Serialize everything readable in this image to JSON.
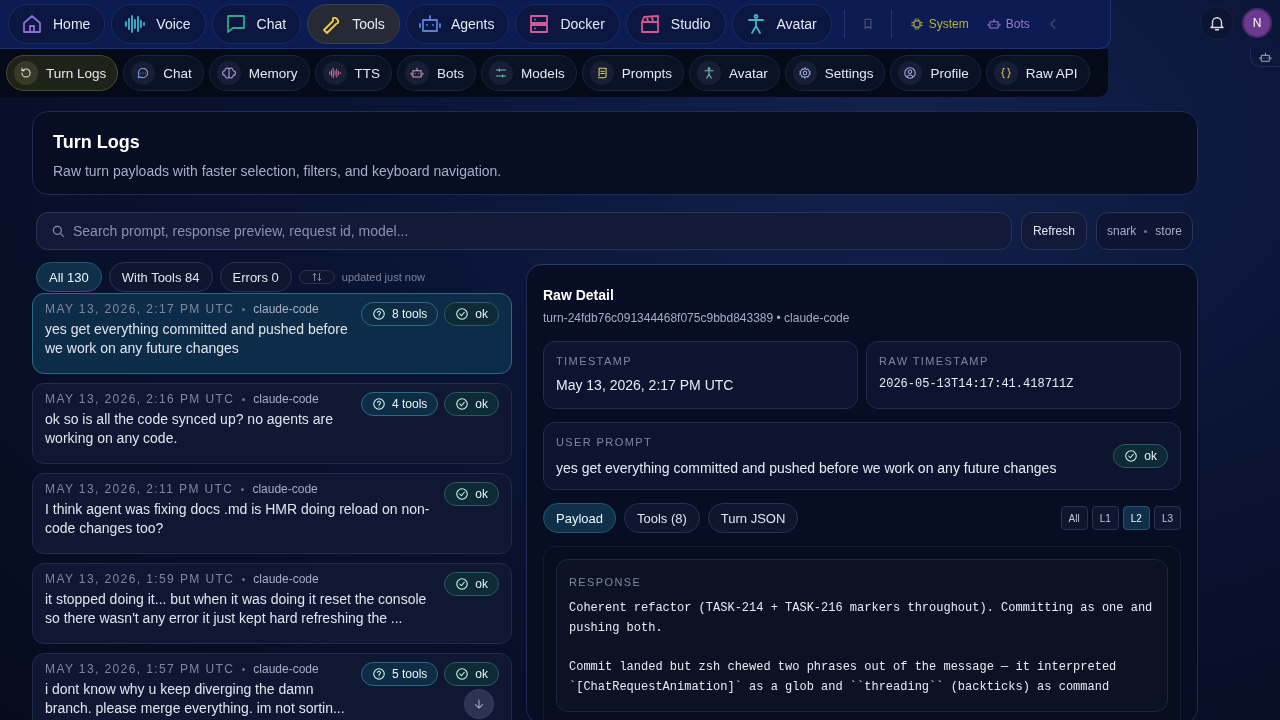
{
  "top_nav": [
    {
      "label": "Home",
      "selected": false
    },
    {
      "label": "Voice",
      "selected": false
    },
    {
      "label": "Chat",
      "selected": false
    },
    {
      "label": "Tools",
      "selected": true
    },
    {
      "label": "Agents",
      "selected": false
    },
    {
      "label": "Docker",
      "selected": false
    },
    {
      "label": "Studio",
      "selected": false
    },
    {
      "label": "Avatar",
      "selected": false
    }
  ],
  "top_links": [
    {
      "label": "System"
    },
    {
      "label": "Bots"
    }
  ],
  "user": {
    "initial": "N"
  },
  "sub_nav": [
    {
      "label": "Turn Logs",
      "selected": true
    },
    {
      "label": "Chat",
      "selected": false
    },
    {
      "label": "Memory",
      "selected": false
    },
    {
      "label": "TTS",
      "selected": false
    },
    {
      "label": "Bots",
      "selected": false
    },
    {
      "label": "Models",
      "selected": false
    },
    {
      "label": "Prompts",
      "selected": false
    },
    {
      "label": "Avatar",
      "selected": false
    },
    {
      "label": "Settings",
      "selected": false
    },
    {
      "label": "Profile",
      "selected": false
    },
    {
      "label": "Raw API",
      "selected": false
    }
  ],
  "header": {
    "title": "Turn Logs",
    "subtitle": "Raw turn payloads with faster selection, filters, and keyboard navigation."
  },
  "search": {
    "placeholder": "Search prompt, response preview, request id, model..."
  },
  "refresh_button": "Refresh",
  "source_chip": {
    "left": "snark",
    "right": "store"
  },
  "filters": [
    {
      "label": "All 130",
      "selected": true
    },
    {
      "label": "With Tools 84",
      "selected": false
    },
    {
      "label": "Errors 0",
      "selected": false
    }
  ],
  "updated": "updated just now",
  "turns": [
    {
      "timestamp": "MAY 13, 2026, 2:17 PM UTC",
      "source": "claude-code",
      "text": "yes get everything committed and pushed before we work on any future changes",
      "tools": "8 tools",
      "status": "ok",
      "selected": true
    },
    {
      "timestamp": "MAY 13, 2026, 2:16 PM UTC",
      "source": "claude-code",
      "text": "ok so is all the code synced up?  no agents are working on any code.",
      "tools": "4 tools",
      "status": "ok",
      "selected": false
    },
    {
      "timestamp": "MAY 13, 2026, 2:11 PM UTC",
      "source": "claude-code",
      "text": "I think agent was fixing docs .md is HMR doing reload on non-code changes too?",
      "status": "ok",
      "selected": false
    },
    {
      "timestamp": "MAY 13, 2026, 1:59 PM UTC",
      "source": "claude-code",
      "text": "it stopped doing it... but when it was doing it reset the console so there wasn't any error it just kept hard refreshing the ...",
      "status": "ok",
      "selected": false
    },
    {
      "timestamp": "MAY 13, 2026, 1:57 PM UTC",
      "source": "claude-code",
      "text": "i dont know why u keep diverging the damn branch.  please merge everything.  im not sortin...",
      "tools": "5 tools",
      "status": "ok",
      "selected": false
    }
  ],
  "detail": {
    "title": "Raw Detail",
    "id_line": "turn-24fdb76c091344468f075c9bbd843389 • claude-code",
    "timestamp": {
      "label": "TIMESTAMP",
      "value": "May 13, 2026, 2:17 PM UTC"
    },
    "raw_timestamp": {
      "label": "RAW TIMESTAMP",
      "value": "2026-05-13T14:17:41.418711Z"
    },
    "user_prompt": {
      "label": "USER PROMPT",
      "text": "yes get everything committed and pushed before we work on any future changes",
      "status": "ok"
    },
    "tabs": [
      {
        "label": "Payload",
        "selected": true
      },
      {
        "label": "Tools (8)",
        "selected": false
      },
      {
        "label": "Turn JSON",
        "selected": false
      }
    ],
    "levels": [
      {
        "label": "All",
        "selected": false
      },
      {
        "label": "L1",
        "selected": false
      },
      {
        "label": "L2",
        "selected": true
      },
      {
        "label": "L3",
        "selected": false
      }
    ],
    "response": {
      "label": "RESPONSE",
      "paragraphs": [
        "Coherent refactor (TASK-214 + TASK-216 markers throughout). Committing as one and pushing both.",
        "Commit landed but zsh chewed two phrases out of the message — it interpreted `[ChatRequestAnimation]` as a glob and ``threading`` (backticks) as command"
      ]
    }
  }
}
